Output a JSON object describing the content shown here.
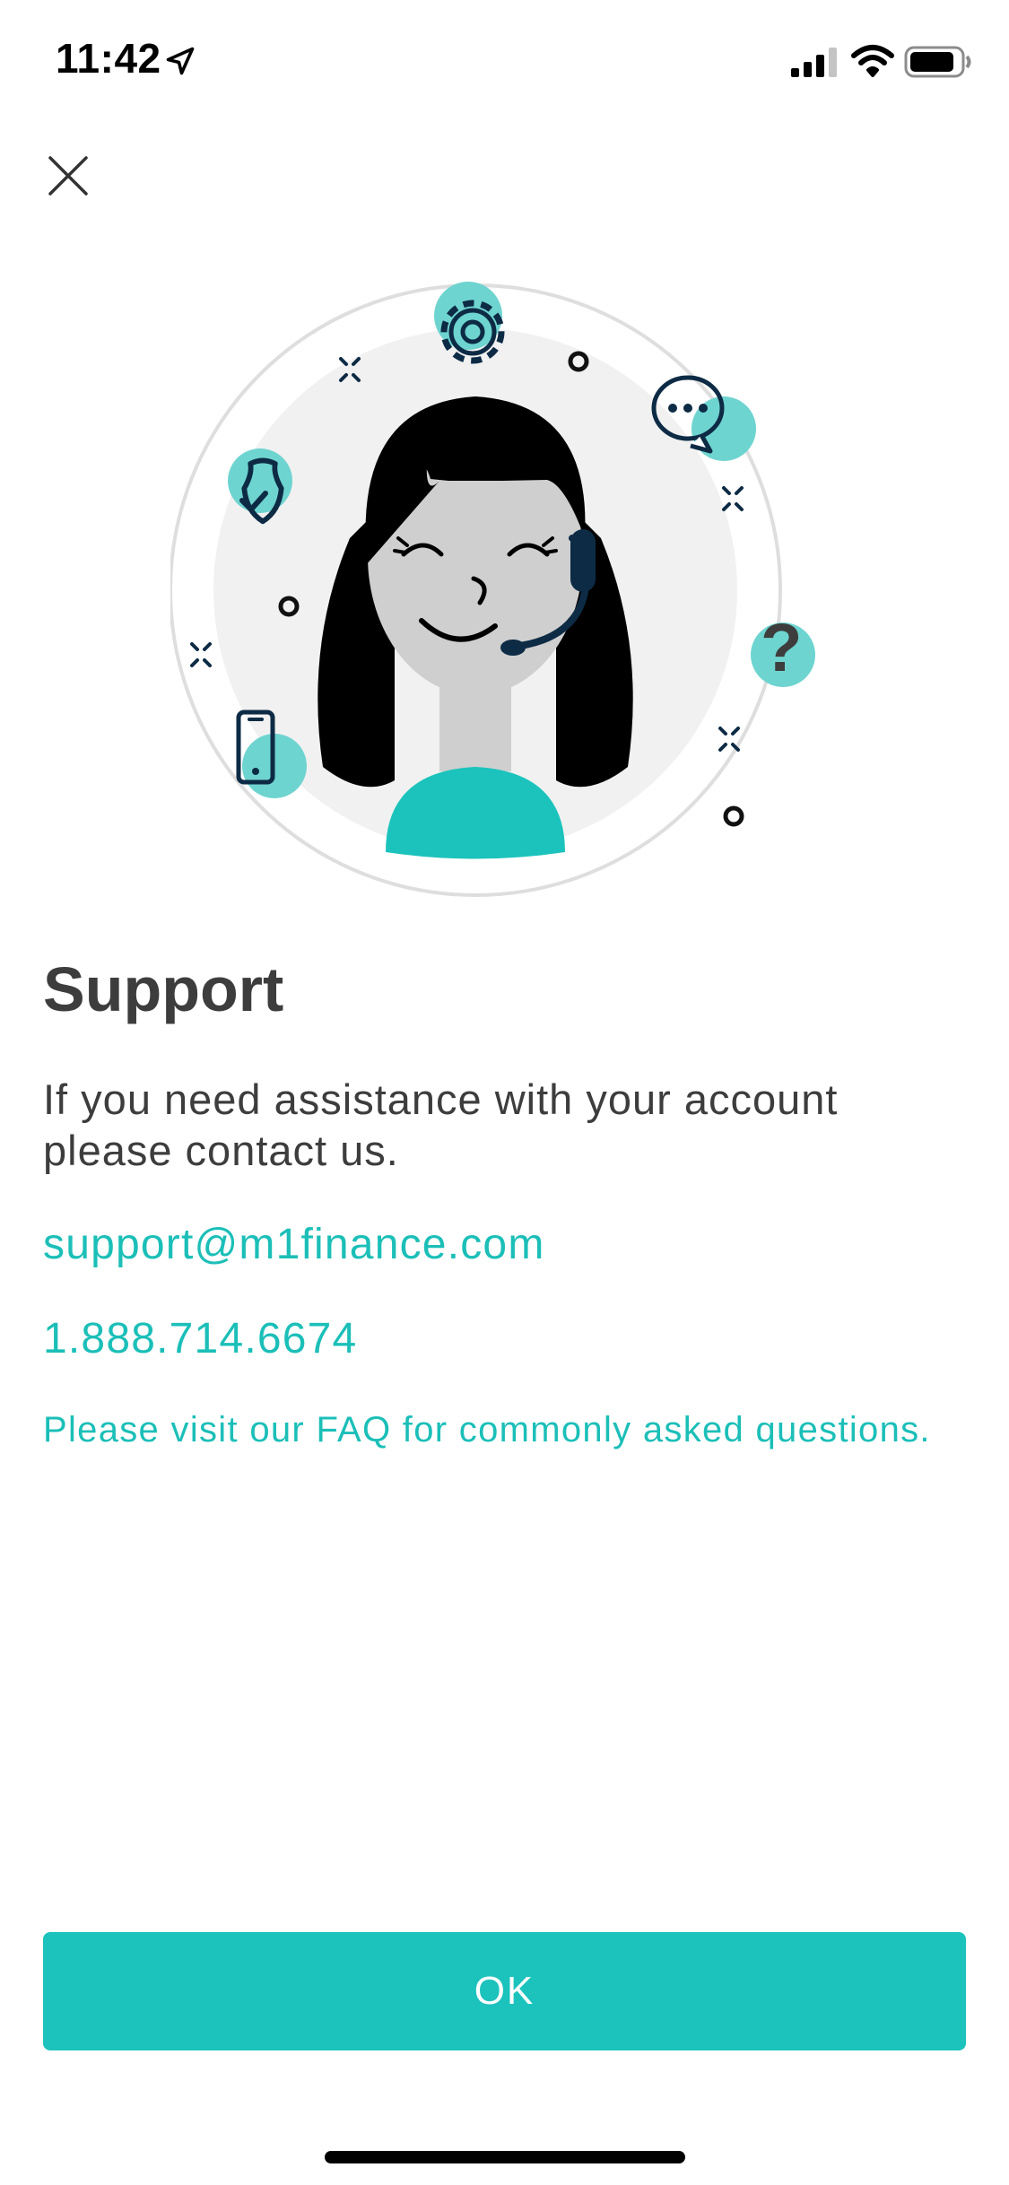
{
  "status_bar": {
    "time": "11:42",
    "icons": [
      "location-arrow-icon",
      "cellular-signal-icon",
      "wifi-icon",
      "battery-icon"
    ]
  },
  "header": {
    "close_icon": "close-icon"
  },
  "illustration": {
    "icons": [
      "gear-icon",
      "chat-bubble-icon",
      "shield-check-icon",
      "question-mark-icon",
      "phone-icon",
      "support-agent-headset"
    ]
  },
  "main": {
    "title": "Support",
    "description": "If you need assistance with your account please contact us.",
    "email": "support@m1finance.com",
    "phone": "1.888.714.6674",
    "faq_text": "Please visit our FAQ for commonly asked questions."
  },
  "footer": {
    "ok_label": "OK"
  },
  "colors": {
    "accent": "#1bc3bc",
    "text": "#3d3d3d",
    "navy": "#0d2b45",
    "light_circle": "#f1f1f1"
  }
}
